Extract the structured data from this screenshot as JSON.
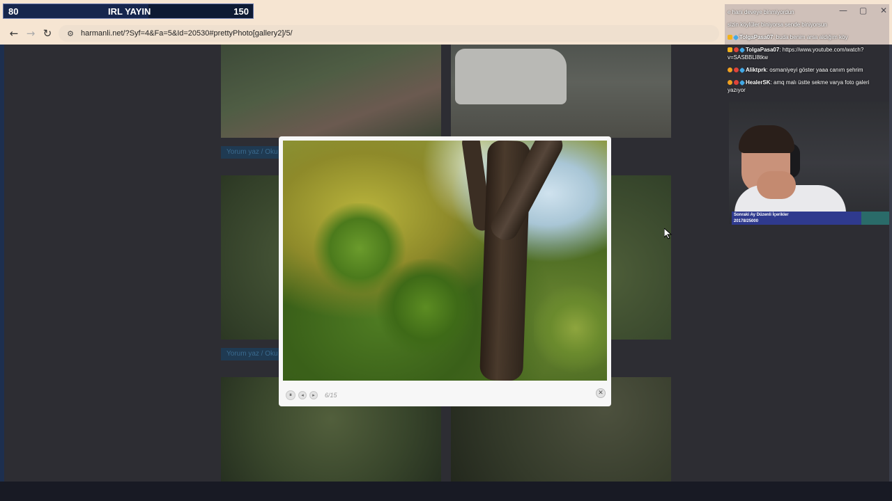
{
  "overlay": {
    "goal_start": "80",
    "goal_title": "IRL YAYIN",
    "goal_end": "150"
  },
  "browser": {
    "url": "harmanli.net/?Syf=4&Fa=5&Id=20530#prettyPhoto[gallery2]/5/",
    "back_icon": "←",
    "forward_icon": "→",
    "reload_icon": "↻",
    "site_info_icon": "⚙",
    "minimize": "—",
    "maximize": "▢",
    "close": "✕"
  },
  "gallery": {
    "comment_link_1": "Yorum yaz / Oku",
    "comment_link_2": "Yorum yaz / Oku"
  },
  "lightbox": {
    "counter": "6/15",
    "pause_icon": "⏸",
    "prev_icon": "◂",
    "next_icon": "▸",
    "close_icon": "✕"
  },
  "chat": {
    "messages": [
      {
        "user": "",
        "text": "e hani deveye binmiyordun"
      },
      {
        "user": "",
        "text": "sizin köylüler biniyorsa sende biniyorsun"
      },
      {
        "user": "TolgaPasa07",
        "text": "buda benim arsa aldığım köy"
      },
      {
        "user": "TolgaPasa07",
        "text": "https://www.youtube.com/watch?v=SASBBLl8tkw"
      },
      {
        "user": "Aliktprk",
        "text": "osmaniyeyi göster yaaa canım şehrim"
      },
      {
        "user": "HealerSK",
        "text": "amq malı üstte sekme varya foto galeri yazıyor"
      }
    ]
  },
  "sub_goal": {
    "title": "Sonraki Ay Düzenli İçerikler",
    "count": "20178/25000"
  },
  "colors": {
    "chrome_bg": "#f6e5d2",
    "goal_bg": "#0e1a33",
    "sub_goal_bg": "#2f3a8e"
  }
}
